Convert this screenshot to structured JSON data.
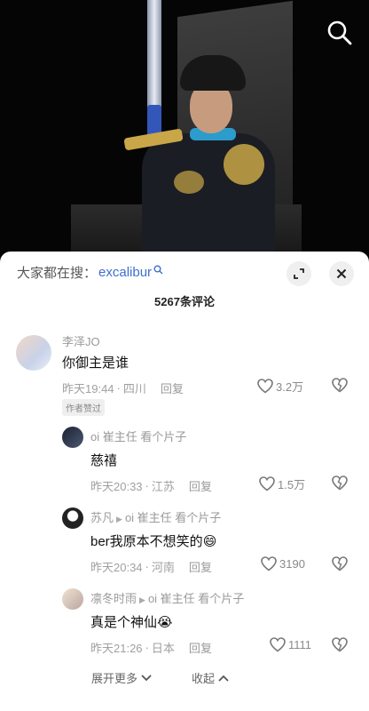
{
  "hot_search": {
    "label": "大家都在搜：",
    "term": "excalibur"
  },
  "comment_count": "5267条评论",
  "comments": [
    {
      "user": "李泽JO",
      "text": "你御主是谁",
      "time": "昨天19:44",
      "location": "四川",
      "reply": "回复",
      "likes": "3.2万",
      "badge": "作者赞过"
    }
  ],
  "replies": [
    {
      "user": "oi 崔主任 看个片子",
      "reply_to": "",
      "text": "慈禧",
      "time": "昨天20:33",
      "location": "江苏",
      "reply": "回复",
      "likes": "1.5万"
    },
    {
      "user": "苏凡",
      "reply_to": "oi 崔主任 看个片子",
      "text": "ber我原本不想笑的",
      "emoji": "😄",
      "time": "昨天20:34",
      "location": "河南",
      "reply": "回复",
      "likes": "3190"
    },
    {
      "user": "凛冬时雨",
      "reply_to": "oi 崔主任 看个片子",
      "text": "真是个神仙",
      "emoji": "😭",
      "time": "昨天21:26",
      "location": "日本",
      "reply": "回复",
      "likes": "1111"
    }
  ],
  "separator": "·",
  "footer": {
    "more": "展开更多",
    "collapse": "收起"
  },
  "icons": [
    "search-icon",
    "expand-icon",
    "close-icon",
    "heart-icon",
    "dislike-icon",
    "chevron-down-icon",
    "chevron-up-icon"
  ],
  "colors": {
    "link": "#3f6fd0",
    "sheet": "#ffffff",
    "muted": "#a0a0a0"
  }
}
